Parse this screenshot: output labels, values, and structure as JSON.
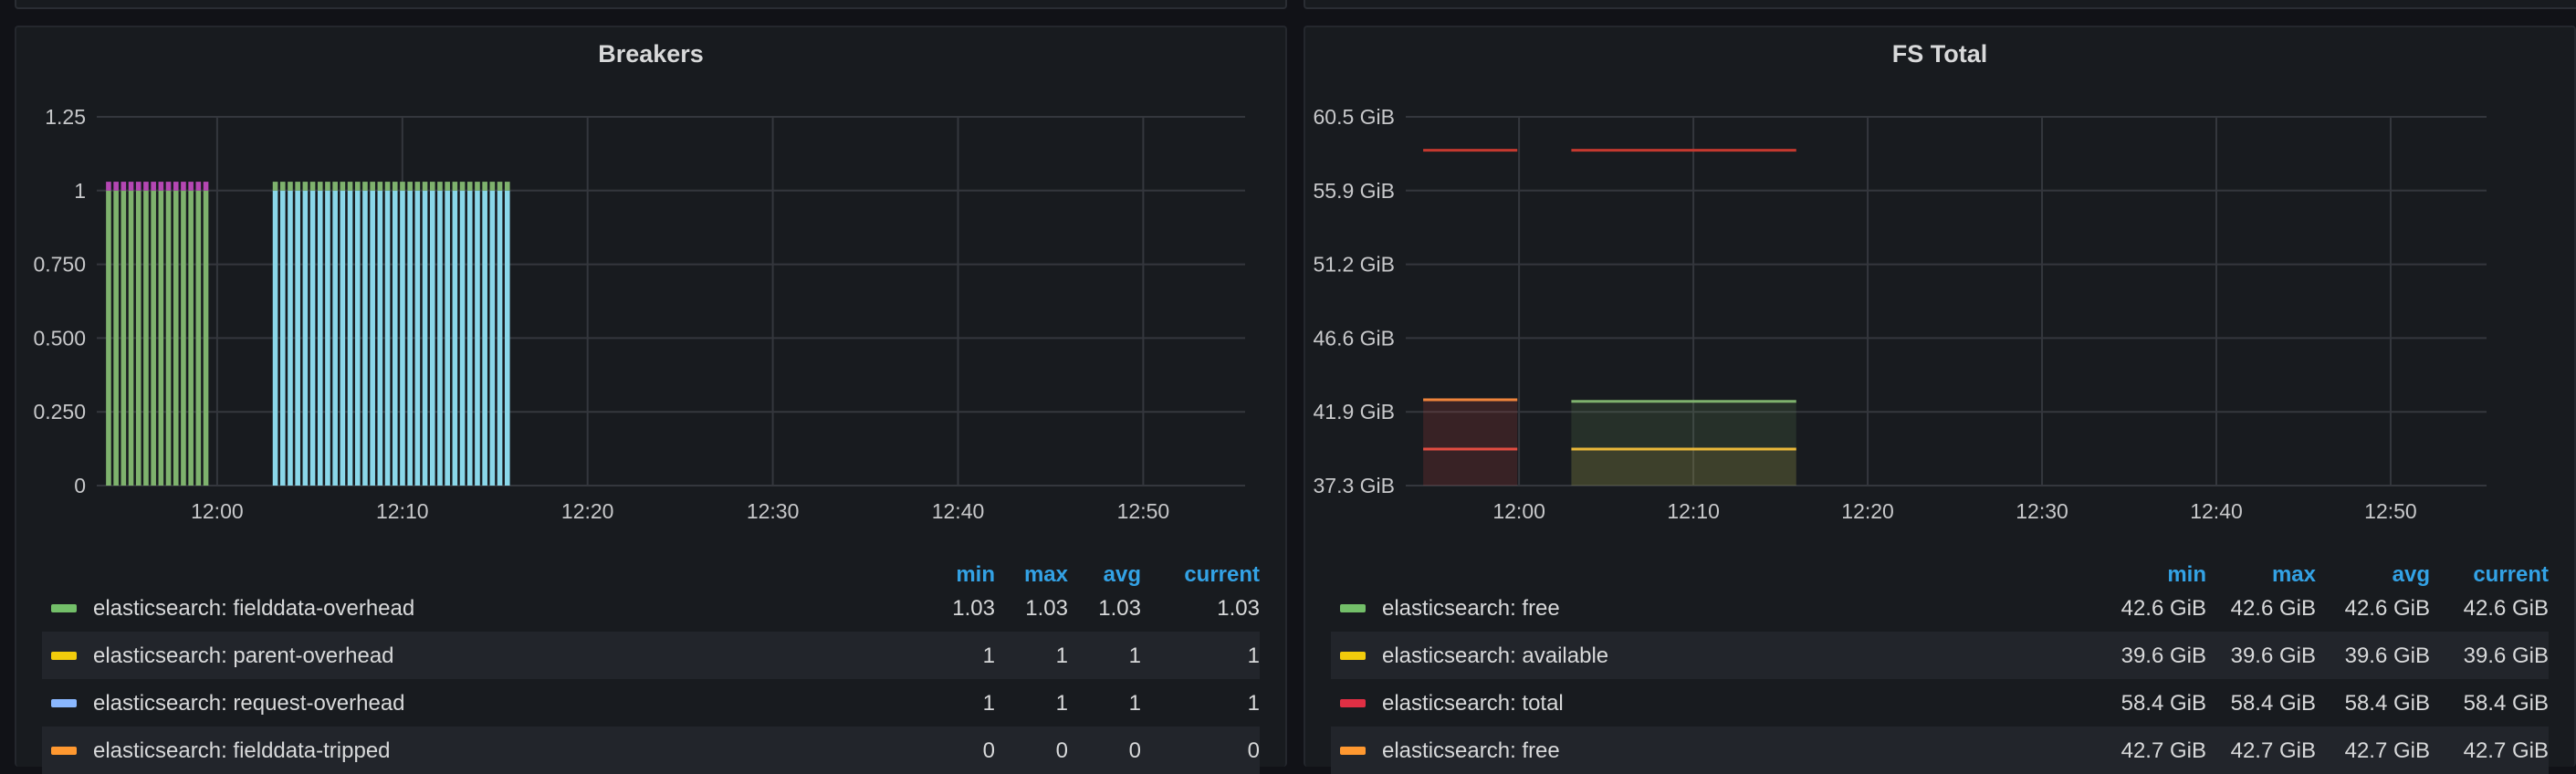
{
  "panels": [
    {
      "title": "Breakers",
      "chart_data": {
        "type": "bar",
        "title": "Breakers",
        "y_ticks": [
          "1.25",
          "1",
          "0.750",
          "0.500",
          "0.250",
          "0"
        ],
        "x_ticks": [
          "12:00",
          "12:10",
          "12:20",
          "12:30",
          "12:40",
          "12:50"
        ],
        "ylim": [
          0,
          1.25
        ],
        "xlim_minutes": [
          "11:53.5",
          "12:55.5"
        ],
        "segments": [
          {
            "start": "11:54",
            "end": "11:59.5"
          },
          {
            "start": "12:03",
            "end": "12:16"
          }
        ],
        "series": [
          {
            "name": "elasticsearch: fielddata-overhead",
            "color": "#7eb26d",
            "segment": 0,
            "value": 1.0
          },
          {
            "name": "elasticsearch: request-overhead",
            "color": "#8ad7e9",
            "segment": 1,
            "value": 1.0
          },
          {
            "name": "elasticsearch: fielddata-overhead",
            "color": "#7eb26d",
            "segment": 1,
            "value": 0.03
          },
          {
            "name": "elasticsearch: parent-overhead",
            "color": "#b547b3",
            "segment": 0,
            "value": 0.03
          }
        ],
        "grid": true
      },
      "legend": {
        "headers": {
          "min": "min",
          "max": "max",
          "avg": "avg",
          "current": "current"
        },
        "rows": [
          {
            "name": "elasticsearch: fielddata-overhead",
            "color": "#73bf69",
            "min": "1.03",
            "max": "1.03",
            "avg": "1.03",
            "current": "1.03"
          },
          {
            "name": "elasticsearch: parent-overhead",
            "color": "#f2cc0c",
            "min": "1",
            "max": "1",
            "avg": "1",
            "current": "1"
          },
          {
            "name": "elasticsearch: request-overhead",
            "color": "#8ab8ff",
            "min": "1",
            "max": "1",
            "avg": "1",
            "current": "1"
          },
          {
            "name": "elasticsearch: fielddata-tripped",
            "color": "#ff9830",
            "min": "0",
            "max": "0",
            "avg": "0",
            "current": "0"
          }
        ]
      }
    },
    {
      "title": "FS Total",
      "chart_data": {
        "type": "line",
        "title": "FS Total",
        "y_ticks": [
          "60.5 GiB",
          "55.9 GiB",
          "51.2 GiB",
          "46.6 GiB",
          "41.9 GiB",
          "37.3 GiB"
        ],
        "x_ticks": [
          "12:00",
          "12:10",
          "12:20",
          "12:30",
          "12:40",
          "12:50"
        ],
        "ylim_gib": [
          37.3,
          60.5
        ],
        "segments": [
          {
            "start": "11:54.5",
            "end": "11:59.9"
          },
          {
            "start": "12:03",
            "end": "12:15.9"
          }
        ],
        "series": [
          {
            "name": "elasticsearch: total",
            "color": "#c4392f",
            "values": [
              {
                "segment": 0,
                "gib": 58.4
              },
              {
                "segment": 1,
                "gib": 58.4
              }
            ]
          },
          {
            "name": "elasticsearch: free",
            "color": "#ef843c",
            "values": [
              {
                "segment": 0,
                "gib": 42.7
              }
            ]
          },
          {
            "name": "elasticsearch: free",
            "color": "#7eb26d",
            "values": [
              {
                "segment": 1,
                "gib": 42.6
              }
            ]
          },
          {
            "name": "elasticsearch: available",
            "color": "#eab839",
            "values": [
              {
                "segment": 1,
                "gib": 39.6
              }
            ]
          },
          {
            "name": "elasticsearch: available",
            "color": "#e24d42",
            "values": [
              {
                "segment": 0,
                "gib": 39.6
              }
            ]
          }
        ],
        "grid": true
      },
      "legend": {
        "headers": {
          "min": "min",
          "max": "max",
          "avg": "avg",
          "current": "current"
        },
        "rows": [
          {
            "name": "elasticsearch: free",
            "color": "#73bf69",
            "min": "42.6 GiB",
            "max": "42.6 GiB",
            "avg": "42.6 GiB",
            "current": "42.6 GiB"
          },
          {
            "name": "elasticsearch: available",
            "color": "#f2cc0c",
            "min": "39.6 GiB",
            "max": "39.6 GiB",
            "avg": "39.6 GiB",
            "current": "39.6 GiB"
          },
          {
            "name": "elasticsearch: total",
            "color": "#e02f44",
            "min": "58.4 GiB",
            "max": "58.4 GiB",
            "avg": "58.4 GiB",
            "current": "58.4 GiB"
          },
          {
            "name": "elasticsearch: free",
            "color": "#ff9830",
            "min": "42.7 GiB",
            "max": "42.7 GiB",
            "avg": "42.7 GiB",
            "current": "42.7 GiB"
          }
        ]
      }
    }
  ]
}
